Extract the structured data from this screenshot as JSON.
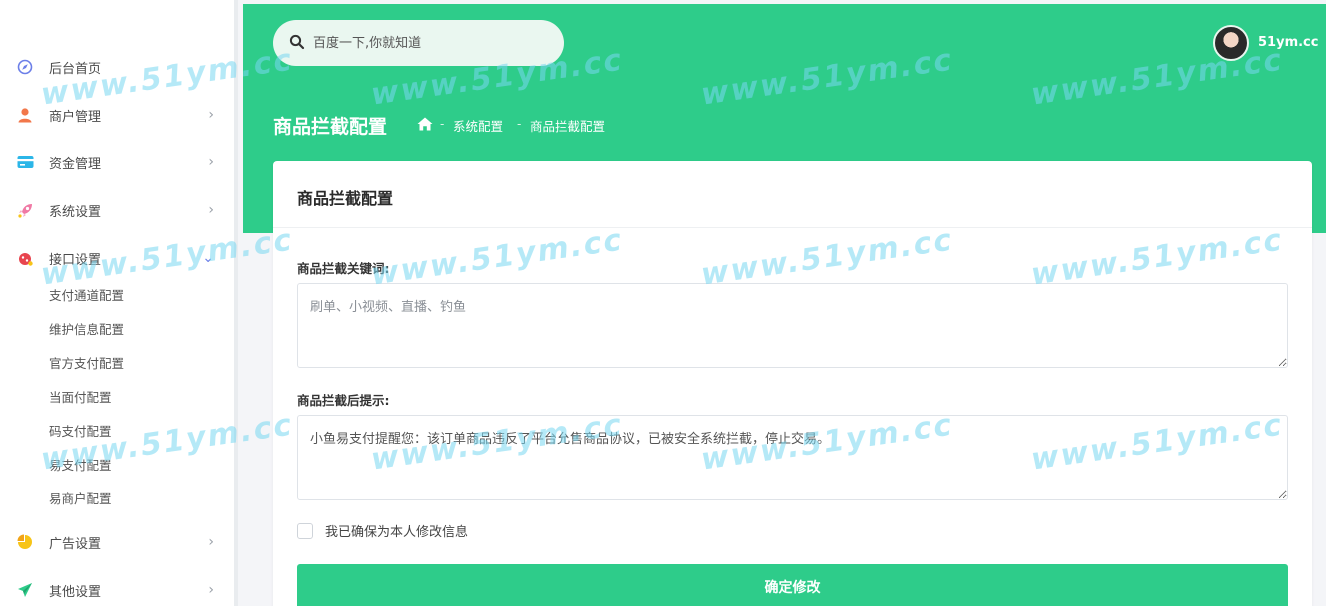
{
  "sidebar": {
    "items": [
      {
        "label": "后台首页",
        "icon": "compass-icon",
        "color": "#6c7fe8",
        "arrow": ""
      },
      {
        "label": "商户管理",
        "icon": "user-icon",
        "color": "#f2774a",
        "arrow": "›"
      },
      {
        "label": "资金管理",
        "icon": "card-icon",
        "color": "#2bb6e8",
        "arrow": "›"
      },
      {
        "label": "系统设置",
        "icon": "rocket-icon",
        "color": "#f07aa5",
        "arrow": "›"
      },
      {
        "label": "接口设置",
        "icon": "bug-icon",
        "color": "#e8454f",
        "arrow": "⌄"
      },
      {
        "label": "广告设置",
        "icon": "pie-chart-icon",
        "color": "#f7c417",
        "arrow": "›"
      },
      {
        "label": "其他设置",
        "icon": "send-icon",
        "color": "#2ecc8a",
        "arrow": "›"
      }
    ],
    "submenu": [
      "支付通道配置",
      "维护信息配置",
      "官方支付配置",
      "当面付配置",
      "码支付配置",
      "易支付配置",
      "易商户配置"
    ]
  },
  "header": {
    "search_placeholder": "百度一下,你就知道",
    "username": "51ym.cc",
    "page_title": "商品拦截配置",
    "breadcrumb": [
      "系统配置",
      "商品拦截配置"
    ],
    "breadcrumb_sep": "-"
  },
  "card": {
    "title": "商品拦截配置",
    "keywords_label": "商品拦截关键词:",
    "keywords_placeholder": "刷单、小视频、直播、钓鱼",
    "tip_label": "商品拦截后提示:",
    "tip_value": "小鱼易支付提醒您：该订单商品违反了平台允售商品协议，已被安全系统拦截，停止交易。",
    "confirm_label": "我已确保为本人修改信息",
    "submit_label": "确定修改"
  },
  "watermark": "www.51ym.cc",
  "colors": {
    "accent": "#2ecc8a"
  }
}
